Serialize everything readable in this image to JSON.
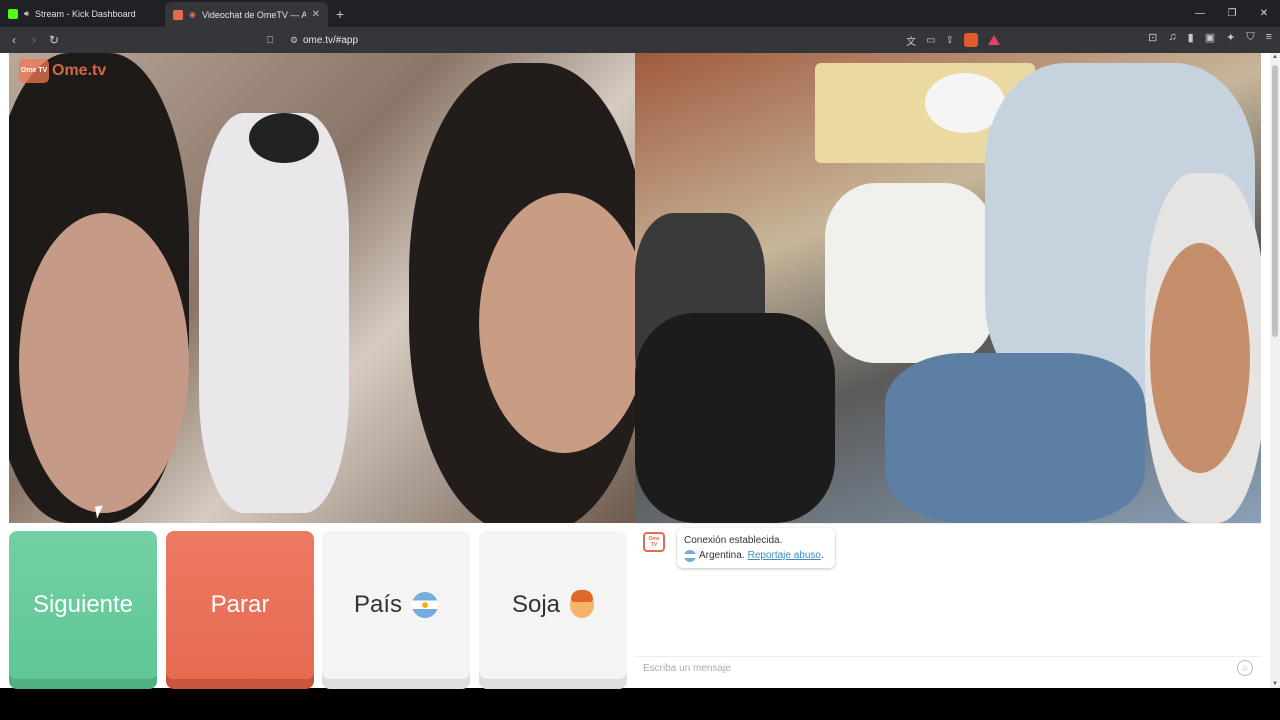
{
  "browser": {
    "tabs": [
      {
        "title": "Stream - Kick Dashboard",
        "active": false,
        "favicon_color": "#53fc18"
      },
      {
        "title": "Videochat de OmeTV — Alte",
        "active": true,
        "favicon_color": "#e56a50"
      }
    ],
    "new_tab_label": "+",
    "address": "ome.tv/#app"
  },
  "page": {
    "logo_text": "Ome.tv",
    "logo_badge": "Ome TV",
    "buttons": {
      "next": "Siguiente",
      "stop": "Parar",
      "country": "País",
      "gender": "Soja"
    },
    "chat": {
      "status": "Conexión establecida.",
      "country": "Argentina.",
      "report_link": "Reportaje abuso",
      "report_suffix": ".",
      "input_placeholder": "Escriba un mensaje"
    }
  },
  "colors": {
    "next_button": "#5fc797",
    "stop_button": "#e56a50",
    "link": "#3c8ec0"
  }
}
